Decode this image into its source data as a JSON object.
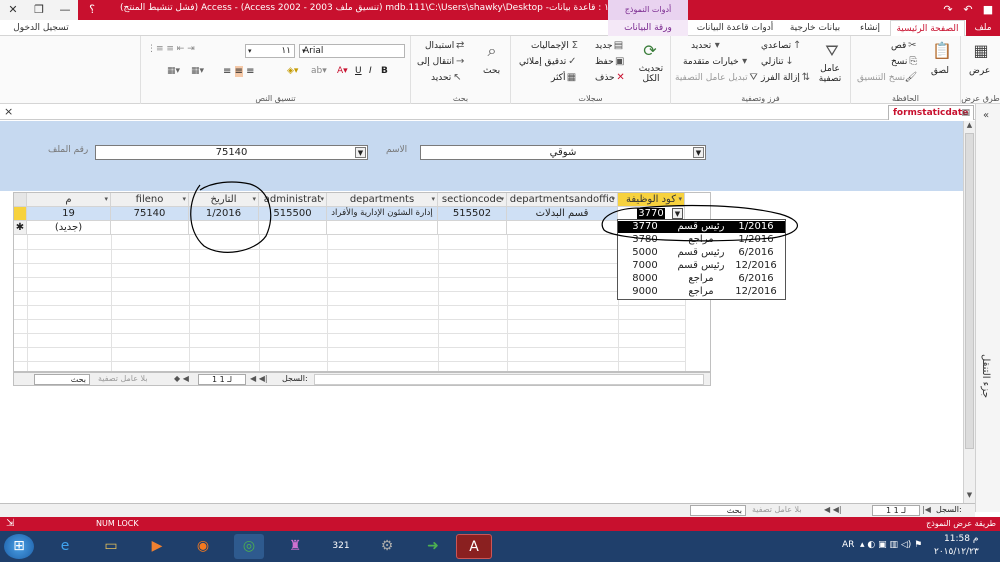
{
  "titlebar": {
    "title": "١١١ : قاعدة بيانات- mdb.111\\C:\\Users\\shawky\\Desktop (تنسيق ملف Access 2002 - 2003) - Access (فشل تنشيط المنتج)",
    "context_header": "أدوات النموذج",
    "sign_in": "تسجيل الدخول",
    "help": "؟",
    "close": "✕",
    "maximize": "□",
    "minimize": "—",
    "restore": "❐"
  },
  "tabs": {
    "file": "ملف",
    "home": "الصفحة الرئيسية",
    "create": "إنشاء",
    "external": "بيانات خارجية",
    "dbtools": "أدوات قاعدة البيانات",
    "datasheet": "ورقة البيانات"
  },
  "ribbon": {
    "views": {
      "view": "عرض",
      "group": "طرق عرض"
    },
    "clipboard": {
      "paste": "لصق",
      "cut": "قص",
      "copy": "نسخ",
      "format_painter": "نسخ التنسيق",
      "group": "الحافظة"
    },
    "sort": {
      "filter": "عامل تصفية",
      "ascending": "تصاعدي",
      "descending": "تنازلي",
      "remove_sort": "إزالة الفرز",
      "selection": "تحديد",
      "advanced": "خيارات متقدمة",
      "toggle": "تبديل عامل التصفية",
      "group": "فرز وتصفية"
    },
    "records": {
      "refresh": "تحديث الكل",
      "new": "جديد",
      "save": "حفظ",
      "delete": "حذف",
      "totals": "الإجماليات",
      "spelling": "تدقيق إملائي",
      "more": "أكثر",
      "group": "سجلات"
    },
    "find": {
      "find": "بحث",
      "replace": "استبدال",
      "goto": "انتقال إلى",
      "select": "تحديد",
      "group": "بحث"
    },
    "text": {
      "font": "Arial",
      "size": "١١",
      "bold": "B",
      "italic": "I",
      "underline": "U",
      "group": "تنسيق النص"
    }
  },
  "doc": {
    "tab_name": "formstaticdate",
    "close": "×"
  },
  "form": {
    "name_label": "الاسم",
    "name_value": "شوقي",
    "fileno_label": "رقم الملف",
    "fileno_value": "75140"
  },
  "datasheet": {
    "headers": [
      "م",
      "fileno",
      "التاريخ",
      "administrat",
      "departments",
      "sectioncode",
      "departmentsandoffic",
      "كود الوظيفة"
    ],
    "row": [
      "19",
      "75140",
      "1/2016",
      "515500",
      "إدارة الشئون الإدارية والأفراد",
      "515502",
      "قسم البدلات",
      "3770"
    ],
    "new_row_label": "(جديد)",
    "nav": {
      "record": "السجل:",
      "pos": "1 لـ 1",
      "filter": "بلا عامل تصفية",
      "search": "بحث"
    }
  },
  "dropdown": {
    "rows": [
      [
        "3770",
        "رئيس قسم",
        "1/2016"
      ],
      [
        "3780",
        "مراجع",
        "1/2016"
      ],
      [
        "5000",
        "رئيس قسم",
        "6/2016"
      ],
      [
        "7000",
        "رئيس قسم",
        "12/2016"
      ],
      [
        "8000",
        "مراجع",
        "6/2016"
      ],
      [
        "9000",
        "مراجع",
        "12/2016"
      ]
    ]
  },
  "bottom_nav": {
    "record": "السجل:",
    "pos": "1 لـ 1",
    "filter": "بلا عامل تصفية",
    "search": "بحث"
  },
  "nav_pane_label": "جزء التنقل",
  "status": {
    "view": "طريقة عرض النموذج",
    "numlock": "NUM LOCK"
  },
  "taskbar": {
    "lang": "AR",
    "time": "11:58 م",
    "date": "٢٠١٥/١٢/٢٣"
  },
  "colors": {
    "accent": "#c8102e",
    "header_bg": "#c6d9f0",
    "taskbar": "#1f3f6b"
  }
}
